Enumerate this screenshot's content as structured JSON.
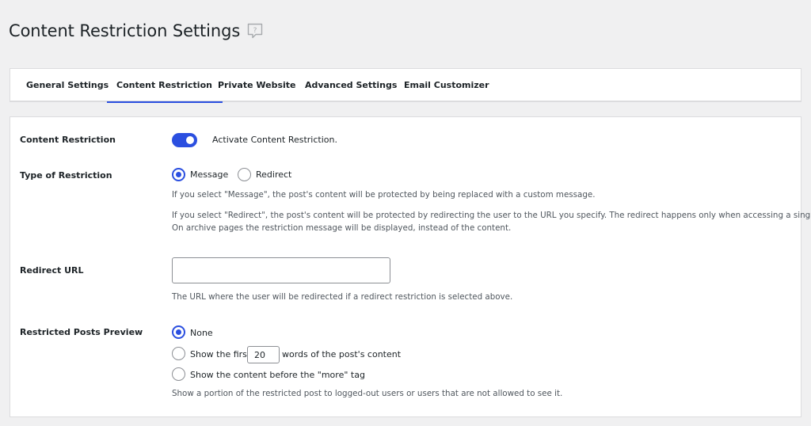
{
  "page": {
    "title": "Content Restriction Settings"
  },
  "tabs": [
    {
      "label": "General Settings",
      "active": false
    },
    {
      "label": "Content Restriction",
      "active": true
    },
    {
      "label": "Private Website",
      "active": false
    },
    {
      "label": "Advanced Settings",
      "active": false
    },
    {
      "label": "Email Customizer",
      "active": false
    }
  ],
  "settings": {
    "content_restriction": {
      "label": "Content Restriction",
      "toggle_on": true,
      "toggle_label": "Activate Content Restriction."
    },
    "type_of_restriction": {
      "label": "Type of Restriction",
      "options": [
        {
          "label": "Message",
          "checked": true
        },
        {
          "label": "Redirect",
          "checked": false
        }
      ],
      "desc_message": "If you select \"Message\", the post's content will be protected by being replaced with a custom message.",
      "desc_redirect_1": "If you select \"Redirect\", the post's content will be protected by redirecting the user to the URL you specify. The redirect happens only when accessing a single post.",
      "desc_redirect_2": "On archive pages the restriction message will be displayed, instead of the content."
    },
    "redirect_url": {
      "label": "Redirect URL",
      "value": "",
      "desc": "The URL where the user will be redirected if a redirect restriction is selected above."
    },
    "restricted_posts_preview": {
      "label": "Restricted Posts Preview",
      "option_none": "None",
      "option_first_before": "Show the first",
      "option_first_value": "20",
      "option_first_after": "words of the post's content",
      "option_more": "Show the content before the \"more\" tag",
      "selected": "None",
      "desc": "Show a portion of the restricted post to logged-out users or users that are not allowed to see it."
    }
  },
  "colors": {
    "accent": "#2b4fe0",
    "background": "#f0f0f1",
    "panel": "#ffffff",
    "muted_text": "#50575e"
  },
  "icons": {
    "help": "help-speech-bubble-icon"
  }
}
